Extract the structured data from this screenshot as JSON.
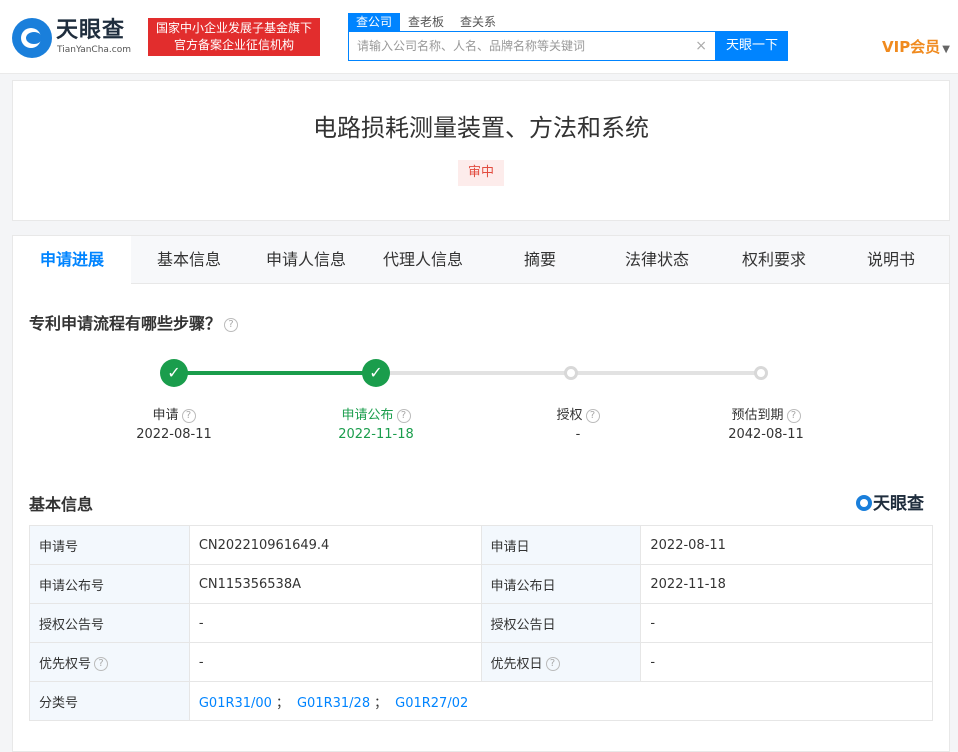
{
  "header": {
    "logo_name": "天眼查",
    "logo_domain": "TianYanCha.com",
    "gov_badge_line1": "国家中小企业发展子基金旗下",
    "gov_badge_line2": "官方备案企业征信机构",
    "search_tabs": [
      "查公司",
      "查老板",
      "查关系"
    ],
    "search_placeholder": "请输入公司名称、人名、品牌名称等关键词",
    "clear_icon": "×",
    "search_button": "天眼一下",
    "vip_label": "VIP会员"
  },
  "patent": {
    "title": "电路损耗测量装置、方法和系统",
    "status": "审中"
  },
  "tabs": [
    "申请进展",
    "基本信息",
    "申请人信息",
    "代理人信息",
    "摘要",
    "法律状态",
    "权利要求",
    "说明书"
  ],
  "progress": {
    "section_title": "专利申请流程有哪些步骤？",
    "steps": [
      {
        "label": "申请",
        "date": "2022-08-11",
        "done": true
      },
      {
        "label": "申请公布",
        "date": "2022-11-18",
        "done": true
      },
      {
        "label": "授权",
        "date": "-",
        "done": false
      },
      {
        "label": "预估到期",
        "date": "2042-08-11",
        "done": false
      }
    ]
  },
  "basic_info": {
    "section_title": "基本信息",
    "brand": "天眼查",
    "rows": [
      {
        "l1": "申请号",
        "v1": "CN202210961649.4",
        "l2": "申请日",
        "v2": "2022-08-11"
      },
      {
        "l1": "申请公布号",
        "v1": "CN115356538A",
        "l2": "申请公布日",
        "v2": "2022-11-18"
      },
      {
        "l1": "授权公告号",
        "v1": "-",
        "l2": "授权公告日",
        "v2": "-"
      },
      {
        "l1": "优先权号",
        "v1": "-",
        "l2": "优先权日",
        "v2": "-"
      }
    ],
    "classification_label": "分类号",
    "classifications": [
      "G01R31/00",
      "G01R31/28",
      "G01R27/02"
    ],
    "classification_sep": "；"
  },
  "colors": {
    "accent": "#0084ff",
    "done_green": "#1a9d4c",
    "gov_red": "#e22d2d",
    "vip_orange": "#f08a1e"
  }
}
